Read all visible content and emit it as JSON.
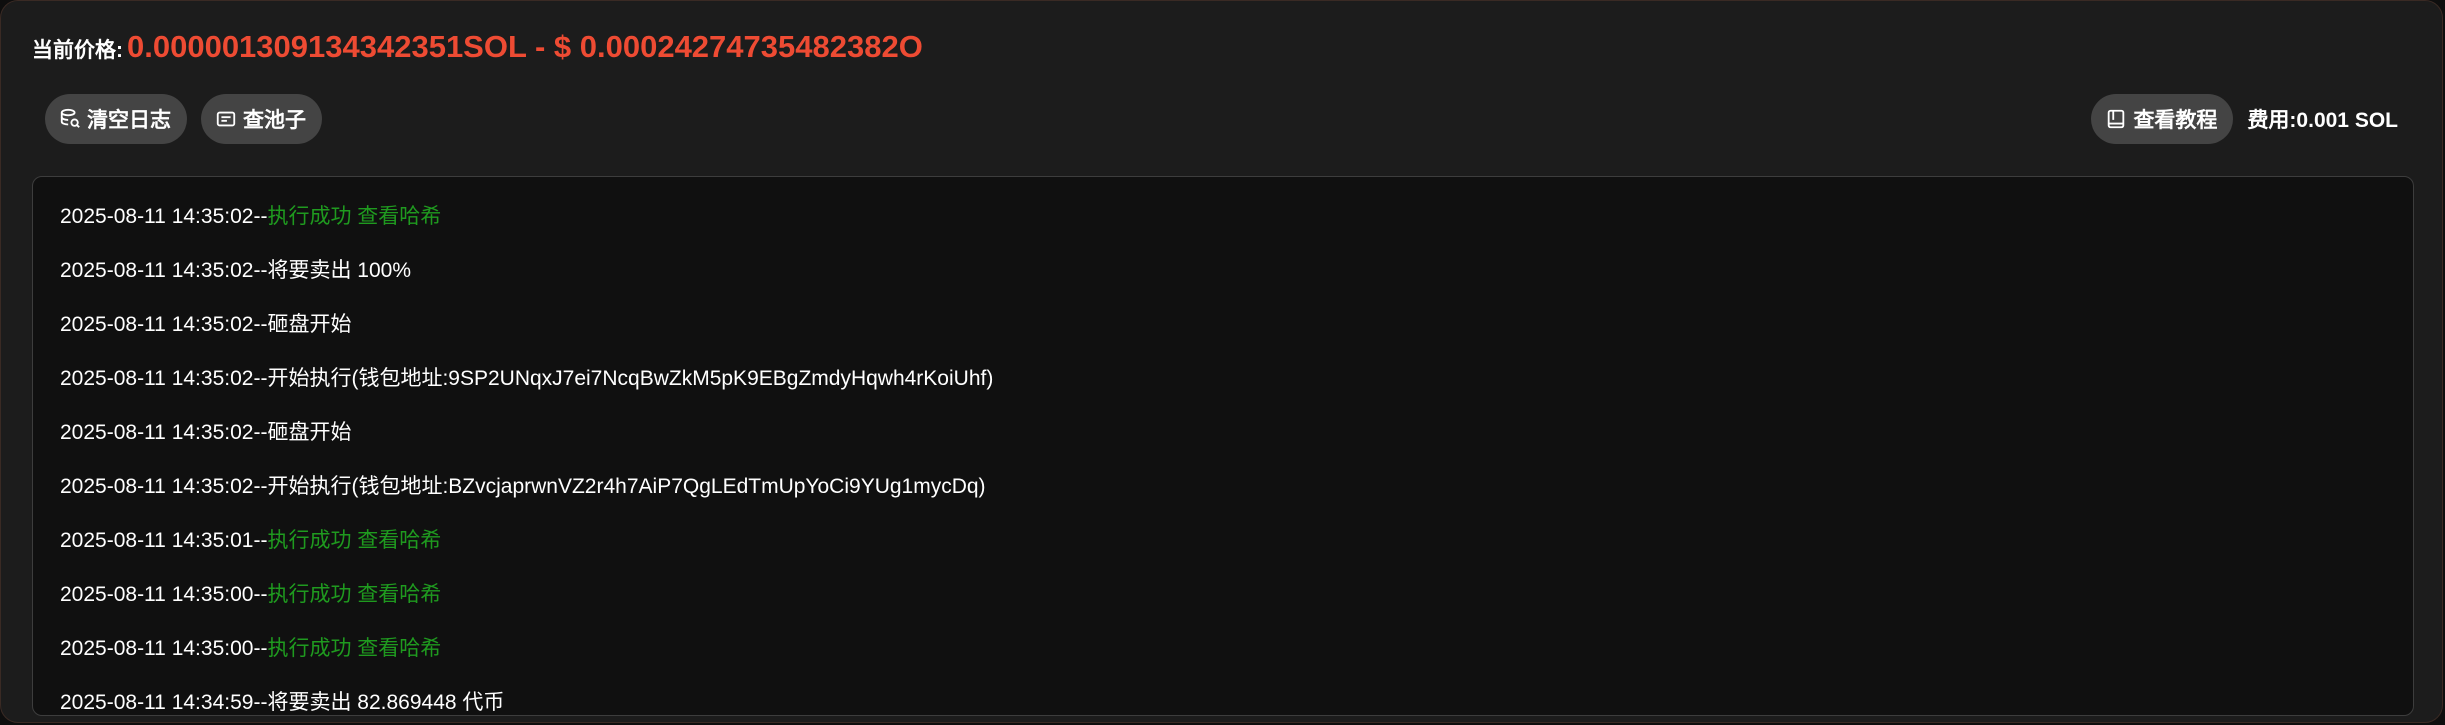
{
  "price": {
    "label": "当前价格:",
    "value": "0.000001309134342351SOL - $ 0.00024274735482382O"
  },
  "toolbar": {
    "clear_log_label": "清空日志",
    "check_pool_label": "查池子",
    "tutorial_label": "查看教程",
    "fee_text": "费用:0.001 SOL"
  },
  "log": [
    {
      "time": "2025-08-11 14:35:02",
      "sep": "--",
      "msg": "执行成功 查看哈希",
      "success": true
    },
    {
      "time": "2025-08-11 14:35:02",
      "sep": "--",
      "msg": "将要卖出 100%",
      "success": false
    },
    {
      "time": "2025-08-11 14:35:02",
      "sep": "--",
      "msg": "砸盘开始",
      "success": false
    },
    {
      "time": "2025-08-11 14:35:02",
      "sep": "--",
      "msg": "开始执行(钱包地址:9SP2UNqxJ7ei7NcqBwZkM5pK9EBgZmdyHqwh4rKoiUhf)",
      "success": false
    },
    {
      "time": "2025-08-11 14:35:02",
      "sep": "--",
      "msg": "砸盘开始",
      "success": false
    },
    {
      "time": "2025-08-11 14:35:02",
      "sep": "--",
      "msg": "开始执行(钱包地址:BZvcjaprwnVZ2r4h7AiP7QgLEdTmUpYoCi9YUg1mycDq)",
      "success": false
    },
    {
      "time": "2025-08-11 14:35:01",
      "sep": "--",
      "msg": "执行成功 查看哈希",
      "success": true
    },
    {
      "time": "2025-08-11 14:35:00",
      "sep": "--",
      "msg": "执行成功 查看哈希",
      "success": true
    },
    {
      "time": "2025-08-11 14:35:00",
      "sep": "--",
      "msg": "执行成功 查看哈希",
      "success": true
    },
    {
      "time": "2025-08-11 14:34:59",
      "sep": "--",
      "msg": "将要卖出 82.869448 代币",
      "success": false
    }
  ],
  "colors": {
    "price_accent": "#ee4b33",
    "success_text": "#1f9a1f",
    "button_bg": "#444444"
  },
  "icons": {
    "clear_log": "database-search-icon",
    "check_pool": "pool-card-icon",
    "tutorial": "book-icon"
  }
}
